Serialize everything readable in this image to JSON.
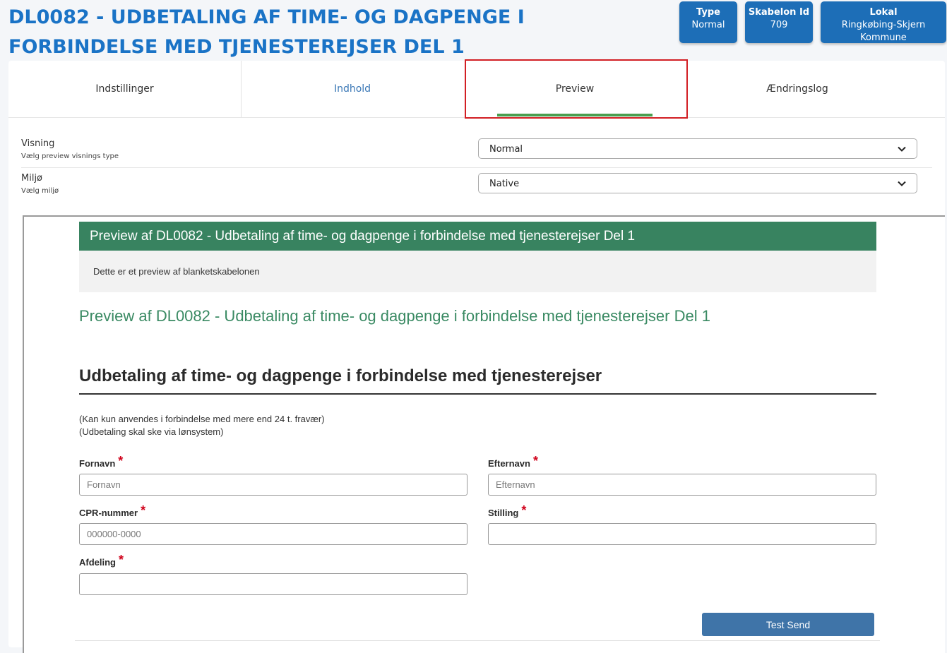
{
  "header": {
    "title": "DL0082 - UDBETALING AF TIME- OG DAGPENGE I FORBINDELSE MED TJENESTEREJSER DEL 1",
    "badges": {
      "type": {
        "label": "Type",
        "value": "Normal"
      },
      "template_id": {
        "label": "Skabelon Id",
        "value": "709"
      },
      "local": {
        "label": "Lokal",
        "value": "Ringkøbing-Skjern Kommune"
      }
    }
  },
  "tabs": [
    {
      "label": "Indstillinger"
    },
    {
      "label": "Indhold"
    },
    {
      "label": "Preview"
    },
    {
      "label": "Ændringslog"
    }
  ],
  "active_tab": "Preview",
  "settings": {
    "visning": {
      "label": "Visning",
      "sub": "Vælg preview visnings type",
      "value": "Normal"
    },
    "miljo": {
      "label": "Miljø",
      "sub": "Vælg miljø",
      "value": "Native"
    }
  },
  "preview": {
    "header": "Preview af DL0082 - Udbetaling af time- og dagpenge i forbindelse med tjenesterejser Del 1",
    "note": "Dette er et preview af blanketskabelonen",
    "subtitle": "Preview af DL0082 - Udbetaling af time- og dagpenge i forbindelse med tjenesterejser Del 1",
    "form_title": "Udbetaling af time- og dagpenge i forbindelse med tjenesterejser",
    "info_lines": [
      "(Kan kun anvendes i forbindelse med mere end 24 t. fravær)",
      "(Udbetaling skal ske via lønsystem)"
    ],
    "fields": {
      "fornavn": {
        "label": "Fornavn",
        "placeholder": "Fornavn"
      },
      "efternavn": {
        "label": "Efternavn",
        "placeholder": "Efternavn"
      },
      "cpr": {
        "label": "CPR-nummer",
        "placeholder": "000000-0000"
      },
      "stilling": {
        "label": "Stilling",
        "placeholder": ""
      },
      "afdeling": {
        "label": "Afdeling",
        "placeholder": ""
      }
    },
    "required_mark": "*",
    "submit_label": "Test Send"
  },
  "colors": {
    "brand_blue": "#1d6eb7",
    "preview_green": "#388360",
    "tab_underline": "#4a9e4f",
    "highlight_red": "#d21f24",
    "button_blue": "#3f74a8"
  }
}
